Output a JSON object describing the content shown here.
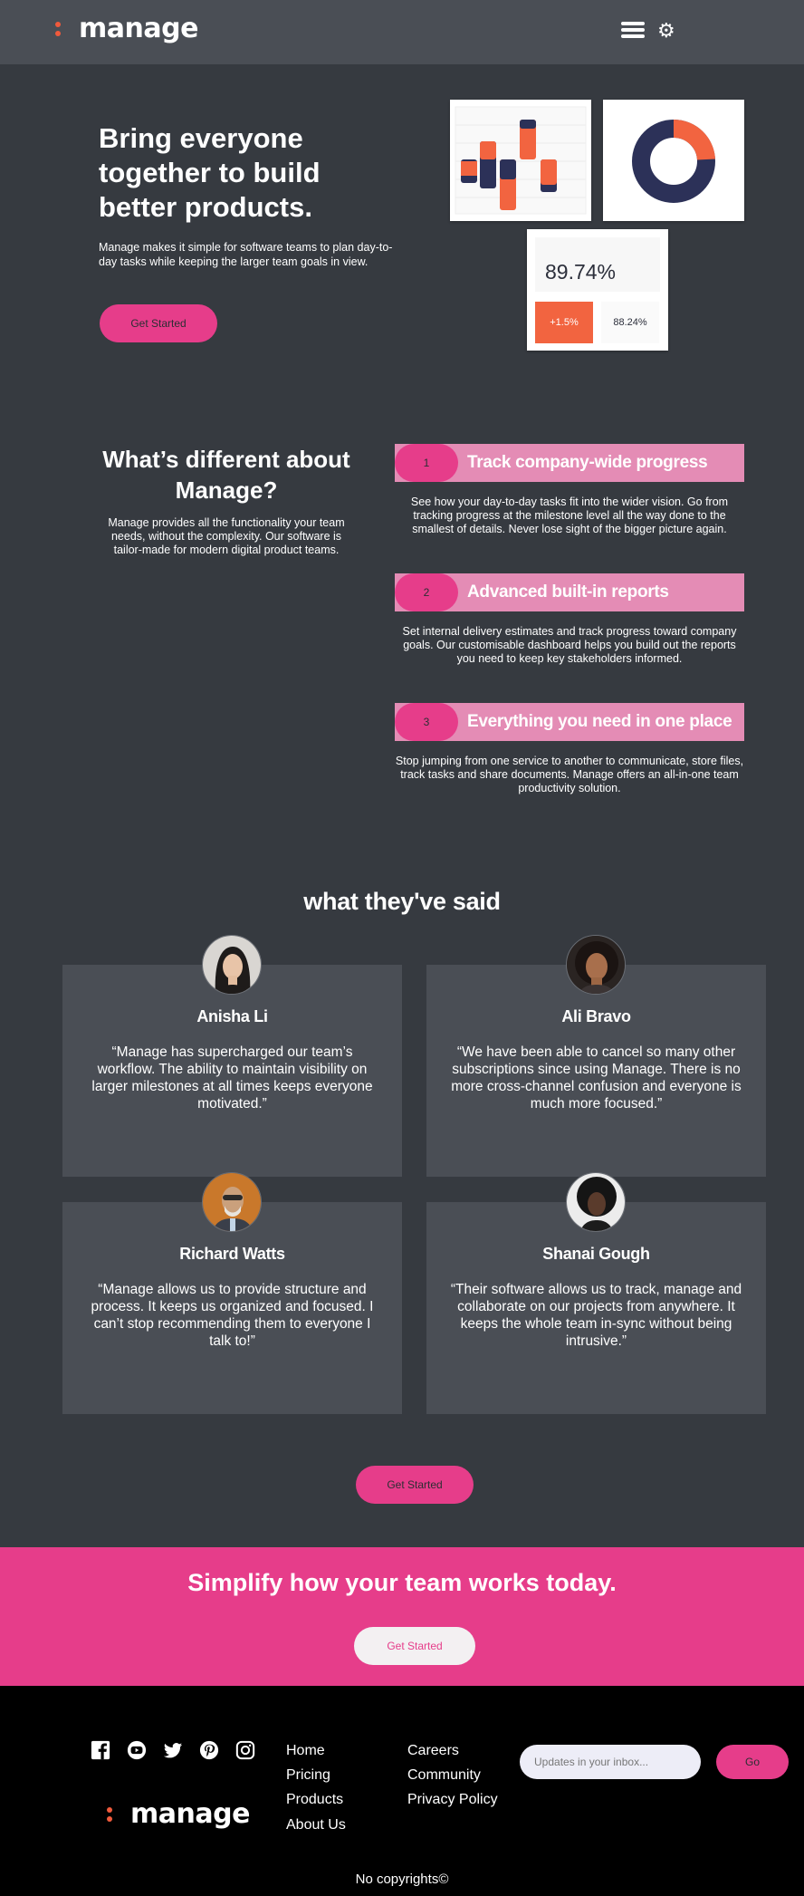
{
  "brand": {
    "name": "manage",
    "accent": "#f05a3c",
    "pink": "#e63d8a"
  },
  "header": {
    "menu_icon": "hamburger-icon",
    "settings_icon": "gear-icon"
  },
  "hero": {
    "title": "Bring everyone together to build better products.",
    "description": "Manage makes it simple for software teams to plan day-to-day tasks while keeping the larger team goals in view.",
    "cta": "Get Started",
    "stats": {
      "main": "89.74%",
      "change": "+1.5%",
      "secondary": "88.24%"
    }
  },
  "features": {
    "title": "What’s different about Manage?",
    "description": "Manage provides all the functionality your team needs, without the complexity. Our software is tailor-made for modern digital product teams.",
    "items": [
      {
        "num": "1",
        "title": "Track company-wide progress",
        "text": "See how your day-to-day tasks fit into the wider vision. Go from tracking progress at the milestone level all the way done to the smallest of details. Never lose sight of the bigger picture again."
      },
      {
        "num": "2",
        "title": "Advanced built-in reports",
        "text": "Set internal delivery estimates and track progress toward company goals. Our customisable dashboard helps you build out the reports you need to keep key stakeholders informed."
      },
      {
        "num": "3",
        "title": "Everything you need in one place",
        "text": "Stop jumping from one service to another to communicate, store files, track tasks and share documents. Manage offers an all-in-one team productivity solution."
      }
    ]
  },
  "testimonials": {
    "title": "what they've said",
    "items": [
      {
        "name": "Anisha Li",
        "quote": "“Manage has supercharged our team’s workflow. The ability to maintain visibility on larger milestones at all times keeps everyone motivated.”"
      },
      {
        "name": "Ali Bravo",
        "quote": "“We have been able to cancel so many other subscriptions since using Manage. There is no more cross-channel confusion and everyone is much more focused.”"
      },
      {
        "name": "Richard Watts",
        "quote": "“Manage allows us to provide structure and process. It keeps us organized and focused. I can’t stop recommending them to everyone I talk to!”"
      },
      {
        "name": "Shanai Gough",
        "quote": "“Their software allows us to track, manage and collaborate on our projects from anywhere. It keeps the whole team in-sync without being intrusive.”"
      }
    ],
    "cta": "Get Started"
  },
  "cta_band": {
    "title": "Simplify how your team works today.",
    "button": "Get Started"
  },
  "footer": {
    "social_icons": [
      "facebook-icon",
      "youtube-icon",
      "twitter-icon",
      "pinterest-icon",
      "instagram-icon"
    ],
    "links_col1": [
      "Home",
      "Pricing",
      "Products",
      "About Us"
    ],
    "links_col2": [
      "Careers",
      "Community",
      "Privacy Policy"
    ],
    "newsletter_placeholder": "Updates in your inbox...",
    "go": "Go",
    "copyright": "No copyrights©"
  }
}
